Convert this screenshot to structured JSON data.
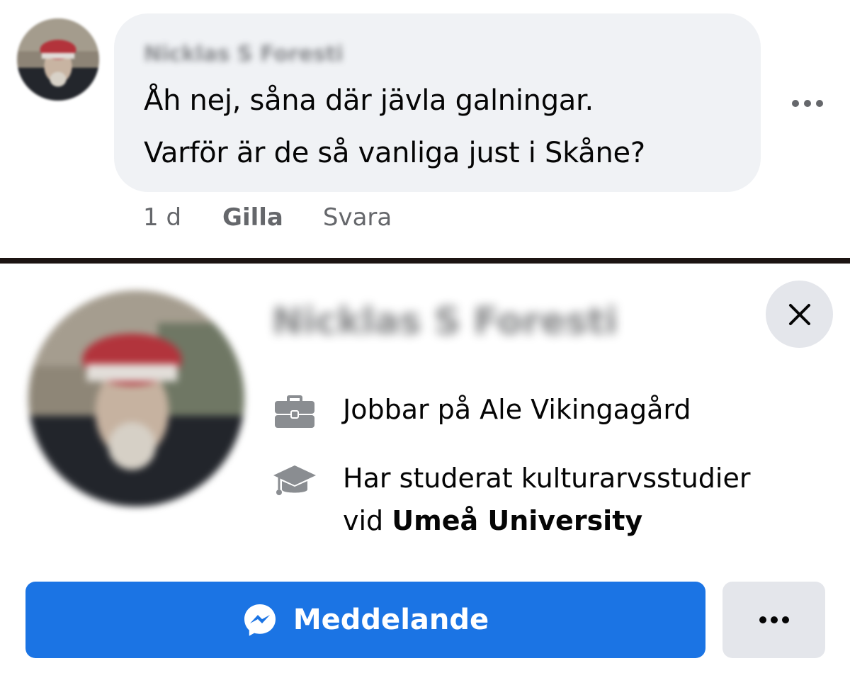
{
  "comment": {
    "author": "Nicklas S Foresti",
    "text_lines": [
      "Åh nej, såna där jävla galningar.",
      "Varför är de så vanliga just i Skåne?"
    ],
    "timestamp": "1 d",
    "like_label": "Gilla",
    "reply_label": "Svara",
    "more_icon": "more-horizontal-icon"
  },
  "profile_card": {
    "name": "Nicklas S Foresti",
    "work": {
      "icon": "briefcase-icon",
      "text": "Jobbar på Ale Vikingagård"
    },
    "education": {
      "icon": "graduation-cap-icon",
      "line1": "Har studerat kulturarvsstudier",
      "line2_prefix": "vid ",
      "line2_bold": "Umeå University"
    },
    "close_icon": "close-icon",
    "message_button_label": "Meddelande",
    "message_icon": "messenger-icon",
    "more_icon": "more-horizontal-icon"
  },
  "colors": {
    "primary_blue": "#1b74e4",
    "bubble_bg": "#f0f2f5",
    "secondary_text": "#65676b",
    "button_gray": "#e4e6eb",
    "divider": "#1c1412"
  }
}
